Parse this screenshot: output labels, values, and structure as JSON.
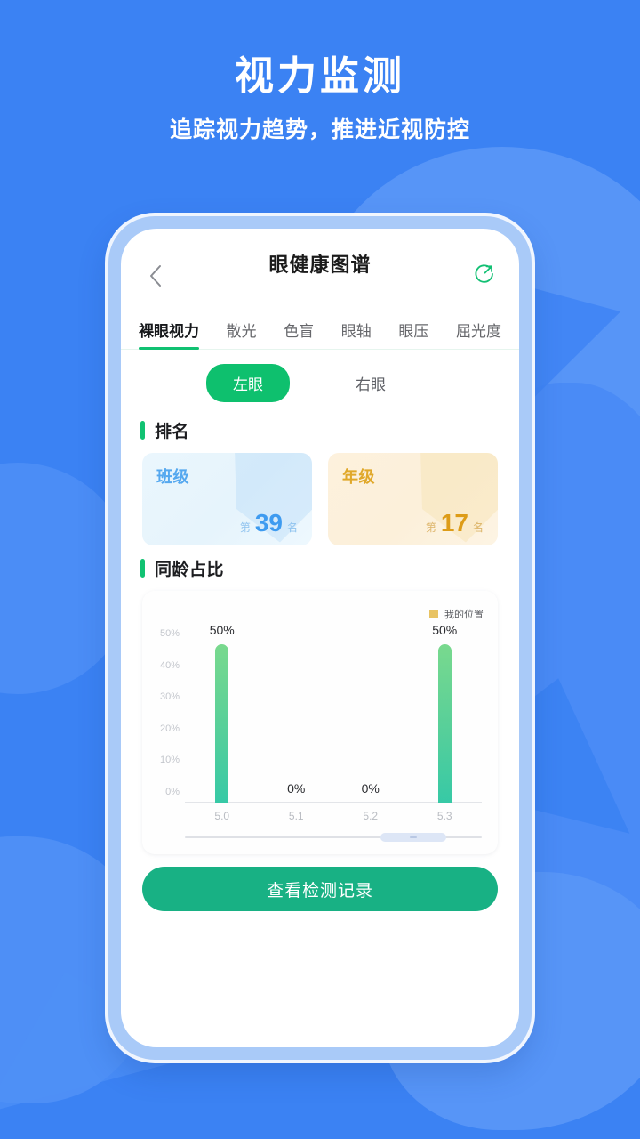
{
  "promo": {
    "title": "视力监测",
    "subtitle": "追踪视力趋势，推进近视防控"
  },
  "app": {
    "navbar": {
      "title": "眼健康图谱",
      "back_icon": "chevron-left-icon",
      "share_icon": "share-circle-icon"
    },
    "tabs": [
      {
        "label": "裸眼视力",
        "active": true
      },
      {
        "label": "散光",
        "active": false
      },
      {
        "label": "色盲",
        "active": false
      },
      {
        "label": "眼轴",
        "active": false
      },
      {
        "label": "眼压",
        "active": false
      },
      {
        "label": "屈光度",
        "active": false
      }
    ],
    "eye_segments": [
      {
        "label": "左眼",
        "active": true
      },
      {
        "label": "右眼",
        "active": false
      }
    ],
    "rank_section": {
      "title": "排名",
      "cards": [
        {
          "label": "班级",
          "prefix": "第",
          "value": "39",
          "suffix": "名",
          "accent": "#3e9bf0"
        },
        {
          "label": "年级",
          "prefix": "第",
          "value": "17",
          "suffix": "名",
          "accent": "#dd9c18"
        }
      ]
    },
    "peer_section": {
      "title": "同龄占比"
    },
    "cta_label": "查看检测记录"
  },
  "chart_data": {
    "type": "bar",
    "title": "同龄占比",
    "categories": [
      "5.0",
      "5.1",
      "5.2",
      "5.3"
    ],
    "values": [
      50,
      0,
      0,
      50
    ],
    "value_labels": [
      "50%",
      "0%",
      "0%",
      "50%"
    ],
    "ytick_labels": [
      "50%",
      "40%",
      "30%",
      "20%",
      "10%",
      "0%"
    ],
    "yticks": [
      50,
      40,
      30,
      20,
      10,
      0
    ],
    "ylim": [
      0,
      50
    ],
    "xlabel": "",
    "ylabel": "",
    "grid": false,
    "legend": [
      {
        "name": "我的位置",
        "color": "#e8c363"
      }
    ],
    "legend_position": "top-right",
    "bar_color_top": "#79d98e",
    "bar_color_bottom": "#37c9a6",
    "scroll": {
      "thumb_start_pct": 66,
      "thumb_width_pct": 22
    }
  },
  "colors": {
    "page_background": "#3b82f3",
    "brand_green": "#10c172",
    "cta_green": "#18b184",
    "phone_frame": "#a9caf8"
  }
}
